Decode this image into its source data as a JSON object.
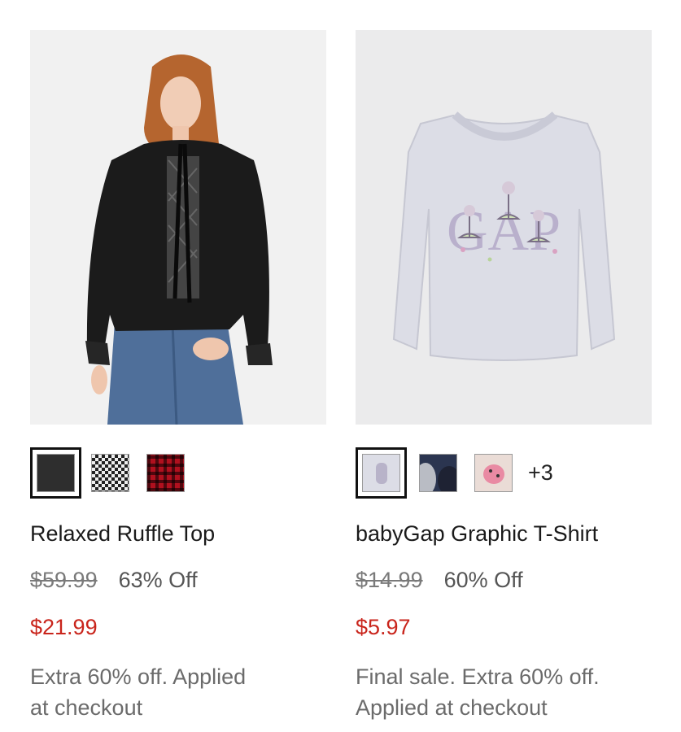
{
  "products": [
    {
      "name": "Relaxed Ruffle Top",
      "original_price": "$59.99",
      "discount": "63% Off",
      "sale_price": "$21.99",
      "promo_line1": "Extra 60% off. Applied",
      "promo_line2": "at checkout",
      "swatches": [
        "black-solid",
        "black-white-gingham",
        "red-black-plaid"
      ],
      "selected_swatch": 0
    },
    {
      "name": "babyGap Graphic T-Shirt",
      "original_price": "$14.99",
      "discount": "60% Off",
      "sale_price": "$5.97",
      "promo_line1": "Final sale. Extra 60% off.",
      "promo_line2": "Applied at checkout",
      "swatches": [
        "lavender-ballerina-print",
        "navy-moon-print",
        "pink-ladybug-print"
      ],
      "selected_swatch": 0,
      "more_swatches": "+3"
    }
  ],
  "colors": {
    "sale_red": "#c9251c",
    "strike_gray": "#7a7a7a",
    "promo_gray": "#6b6b6b"
  }
}
